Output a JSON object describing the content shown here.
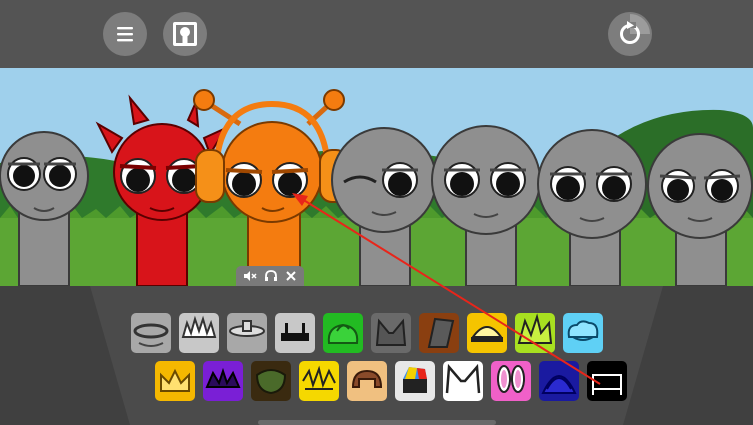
{
  "top_bar": {
    "menu_icon": "hamburger-menu-icon",
    "portrait_icon": "keyhole-portrait-icon",
    "reset_icon": "circular-reset-icon"
  },
  "stage": {
    "characters": [
      {
        "name": "gray",
        "color": "#8f8f8f",
        "state": "idle"
      },
      {
        "name": "red-horned",
        "color": "#d8141a",
        "state": "active"
      },
      {
        "name": "orange-headphones",
        "color": "#f47c10",
        "state": "active"
      },
      {
        "name": "gray",
        "color": "#8f8f8f",
        "state": "idle"
      },
      {
        "name": "gray",
        "color": "#8f8f8f",
        "state": "idle"
      },
      {
        "name": "gray",
        "color": "#8f8f8f",
        "state": "idle"
      },
      {
        "name": "gray",
        "color": "#8f8f8f",
        "state": "idle"
      }
    ]
  },
  "mini_toolbar": {
    "icons": [
      "mute-icon",
      "headphones-icon",
      "close-icon"
    ]
  },
  "palette": {
    "row1": [
      {
        "icon": "gray-ring-hat-icon",
        "bg": "#a8a8a8"
      },
      {
        "icon": "gray-spiky-hair-icon",
        "bg": "#c8c8c8"
      },
      {
        "icon": "gray-saucer-hat-icon",
        "bg": "#a8a8a8"
      },
      {
        "icon": "black-bars-hat-icon",
        "bg": "#c8c8c8"
      },
      {
        "icon": "green-blob-hat-icon",
        "bg": "#22bb22"
      },
      {
        "icon": "gray-cat-ears-icon",
        "bg": "#6a6a6a"
      },
      {
        "icon": "brown-block-hat-icon",
        "bg": "#8a3f10"
      },
      {
        "icon": "yellow-visor-icon",
        "bg": "#f5c400"
      },
      {
        "icon": "lime-spiky-hair-icon",
        "bg": "#a8e020"
      },
      {
        "icon": "cyan-cloud-hat-icon",
        "bg": "#5fd0f5"
      }
    ],
    "row2": [
      {
        "icon": "yellow-crown-icon",
        "bg": "#f5b800"
      },
      {
        "icon": "purple-tiara-icon",
        "bg": "#7a1fd6"
      },
      {
        "icon": "dark-bowl-hat-icon",
        "bg": "#3a2a10"
      },
      {
        "icon": "yellow-scribble-hair-icon",
        "bg": "#f5d800"
      },
      {
        "icon": "tan-hair-icon",
        "bg": "#f0c080"
      },
      {
        "icon": "rainbow-box-icon",
        "bg": "#e8e8e8"
      },
      {
        "icon": "white-cat-ears-icon",
        "bg": "#ffffff"
      },
      {
        "icon": "pink-bunny-ears-icon",
        "bg": "#f060c8"
      },
      {
        "icon": "navy-dome-icon",
        "bg": "#1a1aa0"
      },
      {
        "icon": "black-frame-icon",
        "bg": "#000000"
      }
    ]
  },
  "drag_arrow": {
    "color": "#e8251a"
  }
}
